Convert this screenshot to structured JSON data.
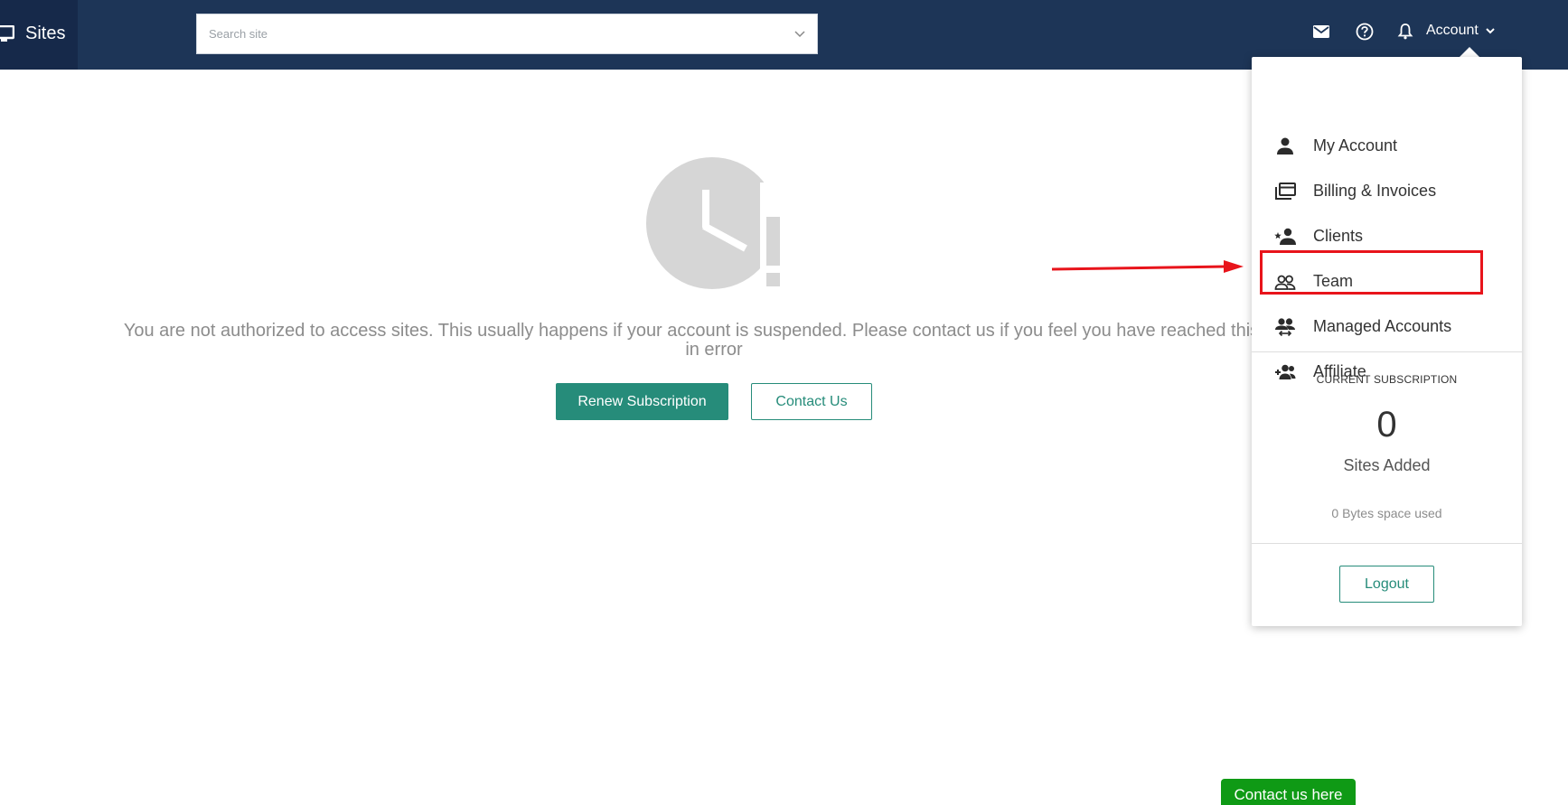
{
  "brand": {
    "label": "Sites",
    "icon": "monitor-icon"
  },
  "search": {
    "placeholder": "Search site",
    "value": ""
  },
  "header": {
    "icons": [
      "mail-icon",
      "help-icon",
      "bell-icon"
    ],
    "account_label": "Account"
  },
  "main": {
    "icon": "clock-warning-icon",
    "error_text": "You are not authorized to access sites. This usually happens if your account is suspended. Please contact us if you feel you have reached this page in error",
    "renew_label": "Renew Subscription",
    "contact_label": "Contact Us"
  },
  "dropdown": {
    "items": [
      {
        "label": "My Account",
        "icon": "person-icon"
      },
      {
        "label": "Billing & Invoices",
        "icon": "billing-icon"
      },
      {
        "label": "Clients",
        "icon": "client-star-icon"
      },
      {
        "label": "Team",
        "icon": "team-icon"
      },
      {
        "label": "Managed Accounts",
        "icon": "managed-accounts-icon"
      },
      {
        "label": "Affiliate",
        "icon": "affiliate-icon"
      }
    ],
    "subscription": {
      "title": "CURRENT SUBSCRIPTION",
      "count": "0",
      "sites_label": "Sites Added",
      "space_used": "0 Bytes space used"
    },
    "logout_label": "Logout"
  },
  "annotation": {
    "highlight_color": "#e8141b"
  },
  "chat": {
    "label": "Contact us here"
  },
  "colors": {
    "topbar": "#1d3557",
    "accent": "#268c7a",
    "chat": "#0f9a15"
  }
}
